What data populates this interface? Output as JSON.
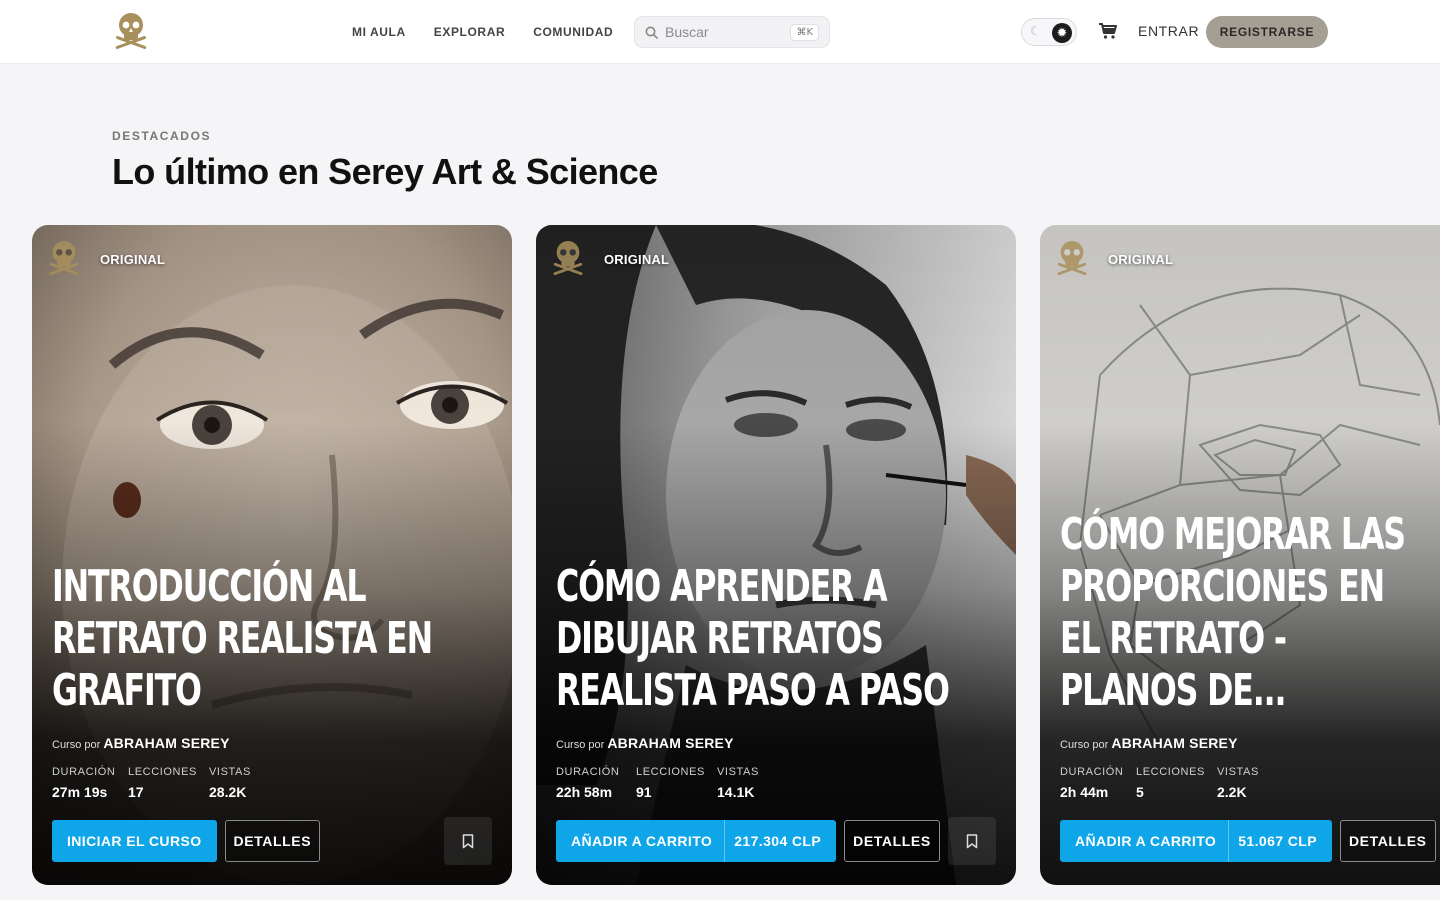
{
  "nav": {
    "logo": "skull-crossbones-logo",
    "menu": [
      "MI AULA",
      "EXPLORAR",
      "COMUNIDAD"
    ],
    "search_placeholder": "Buscar",
    "search_shortcut": "⌘K",
    "login": "ENTRAR",
    "register": "REGISTRARSE"
  },
  "section": {
    "eyebrow": "DESTACADOS",
    "title": "Lo último en Serey Art & Science"
  },
  "cards": [
    {
      "badge": "ORIGINAL",
      "title": "INTRODUCCIÓN AL RETRATO REALISTA EN GRAFITO",
      "author_prefix": "Curso por",
      "author": "ABRAHAM SEREY",
      "stats": [
        {
          "label": "DURACIÓN",
          "value": "27m 19s"
        },
        {
          "label": "LECCIONES",
          "value": "17"
        },
        {
          "label": "VISTAS",
          "value": "28.2K"
        }
      ],
      "primary": "INICIAR EL CURSO",
      "secondary": "DETALLES"
    },
    {
      "badge": "ORIGINAL",
      "title": "CÓMO APRENDER A DIBUJAR RETRATOS REALISTA PASO A PASO",
      "author_prefix": "Curso por",
      "author": "ABRAHAM SEREY",
      "stats": [
        {
          "label": "DURACIÓN",
          "value": "22h 58m"
        },
        {
          "label": "LECCIONES",
          "value": "91"
        },
        {
          "label": "VISTAS",
          "value": "14.1K"
        }
      ],
      "primary": "AÑADIR A CARRITO",
      "price": "217.304 CLP",
      "secondary": "DETALLES"
    },
    {
      "badge": "ORIGINAL",
      "title": "CÓMO MEJORAR LAS PROPORCIONES EN EL RETRATO - PLANOS DE...",
      "author_prefix": "Curso por",
      "author": "ABRAHAM SEREY",
      "stats": [
        {
          "label": "DURACIÓN",
          "value": "2h 44m"
        },
        {
          "label": "LECCIONES",
          "value": "5"
        },
        {
          "label": "VISTAS",
          "value": "2.2K"
        }
      ],
      "primary": "AÑADIR A CARRITO",
      "price": "51.067 CLP",
      "secondary": "DETALLES"
    }
  ],
  "colors": {
    "accent": "#0ea5e9",
    "register_bg": "#a59e93",
    "skull_gold": "#a8905c"
  }
}
